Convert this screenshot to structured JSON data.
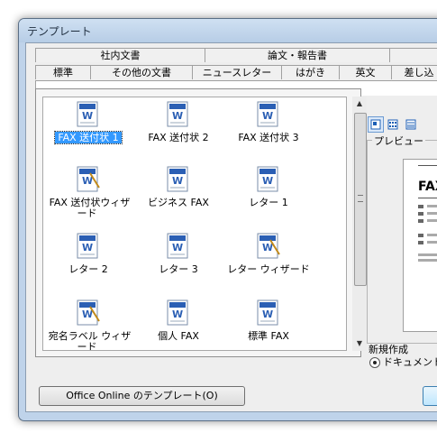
{
  "window": {
    "title": "テンプレート"
  },
  "tabs_row1": [
    "社内文書",
    "論文・報告書",
    ""
  ],
  "tabs_row2": [
    "標準",
    "その他の文書",
    "ニュースレター",
    "はがき",
    "英文",
    "差し込"
  ],
  "templates": [
    {
      "label": "FAX 送付状 1",
      "selected": true
    },
    {
      "label": "FAX 送付状 2"
    },
    {
      "label": "FAX 送付状 3"
    },
    {
      "label": "FAX 送付状ウィザード",
      "wizard": true
    },
    {
      "label": "ビジネス FAX"
    },
    {
      "label": "レター 1"
    },
    {
      "label": "レター 2"
    },
    {
      "label": "レター 3"
    },
    {
      "label": "レター ウィザード",
      "wizard": true
    },
    {
      "label": "宛名ラベル ウィザード",
      "wizard": true
    },
    {
      "label": "個人 FAX"
    },
    {
      "label": "標準 FAX"
    }
  ],
  "preview": {
    "label": "プレビュー",
    "page_heading": "FAX"
  },
  "new_section": {
    "label": "新規作成",
    "option_document": "ドキュメント(D"
  },
  "buttons": {
    "online": "Office Online のテンプレート(O)",
    "ok": ""
  },
  "icons": {
    "template": "word-template-icon",
    "wizard": "word-wizard-icon"
  },
  "colors": {
    "selection": "#3399ff",
    "titlebar": "#bfd3ea"
  }
}
